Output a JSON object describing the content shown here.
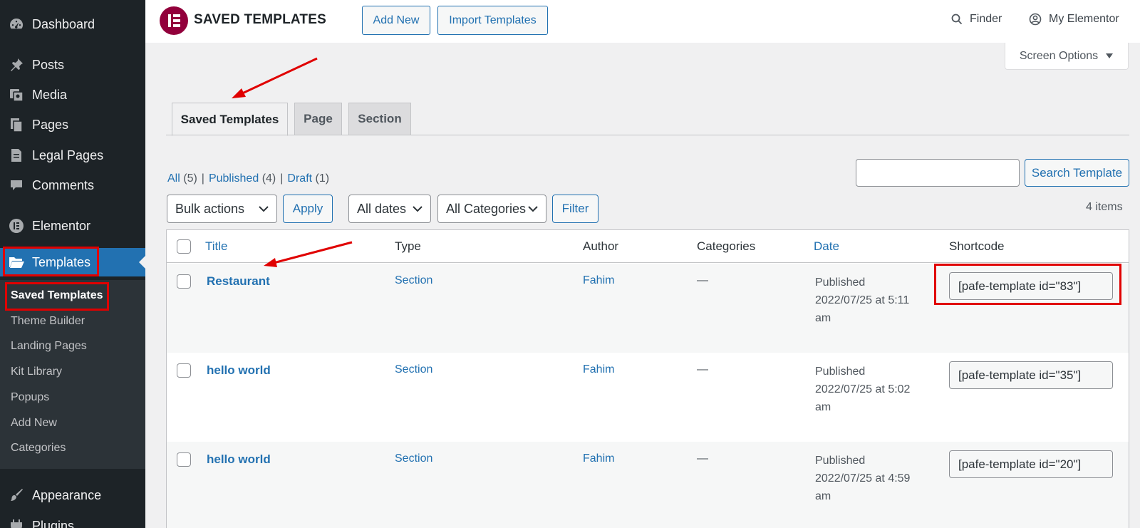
{
  "sidebar": {
    "items": [
      {
        "label": "Dashboard",
        "icon": "dashboard-icon"
      },
      {
        "label": "Posts",
        "icon": "pin-icon"
      },
      {
        "label": "Media",
        "icon": "media-icon"
      },
      {
        "label": "Pages",
        "icon": "pages-icon"
      },
      {
        "label": "Legal Pages",
        "icon": "document-icon"
      },
      {
        "label": "Comments",
        "icon": "comment-icon"
      },
      {
        "label": "Elementor",
        "icon": "elementor-icon"
      },
      {
        "label": "Templates",
        "icon": "folder-icon",
        "active": true
      },
      {
        "label": "Appearance",
        "icon": "brush-icon"
      },
      {
        "label": "Plugins",
        "icon": "plugin-icon"
      }
    ],
    "submenu": [
      "Saved Templates",
      "Theme Builder",
      "Landing Pages",
      "Kit Library",
      "Popups",
      "Add New",
      "Categories"
    ]
  },
  "header": {
    "title": "SAVED TEMPLATES",
    "add_new": "Add New",
    "import": "Import Templates",
    "finder": "Finder",
    "my_elementor": "My Elementor"
  },
  "screen_options": "Screen Options",
  "tabs": [
    "Saved Templates",
    "Page",
    "Section"
  ],
  "filters": {
    "all": "All",
    "all_count": "(5)",
    "published": "Published",
    "published_count": "(4)",
    "draft": "Draft",
    "draft_count": "(1)",
    "bulk_actions": "Bulk actions",
    "apply": "Apply",
    "all_dates": "All dates",
    "all_categories": "All Categories",
    "filter": "Filter",
    "search_button": "Search Template",
    "search_value": "",
    "items_count": "4 items"
  },
  "table": {
    "columns": [
      "Title",
      "Type",
      "Author",
      "Categories",
      "Date",
      "Shortcode"
    ],
    "rows": [
      {
        "title": "Restaurant",
        "type": "Section",
        "author": "Fahim",
        "categories": "—",
        "status": "Published",
        "date": "2022/07/25 at 5:11",
        "date_suffix": "am",
        "shortcode": "[pafe-template id=\"83\"]"
      },
      {
        "title": "hello world",
        "type": "Section",
        "author": "Fahim",
        "categories": "—",
        "status": "Published",
        "date": "2022/07/25 at 5:02",
        "date_suffix": "am",
        "shortcode": "[pafe-template id=\"35\"]"
      },
      {
        "title": "hello world",
        "type": "Section",
        "author": "Fahim",
        "categories": "—",
        "status": "Published",
        "date": "2022/07/25 at 4:59",
        "date_suffix": "am",
        "shortcode": "[pafe-template id=\"20\"]"
      }
    ]
  },
  "colors": {
    "sidebar": "#1d2327",
    "accent": "#2271b1",
    "elementor": "#92003b",
    "highlight": "#e00000"
  }
}
